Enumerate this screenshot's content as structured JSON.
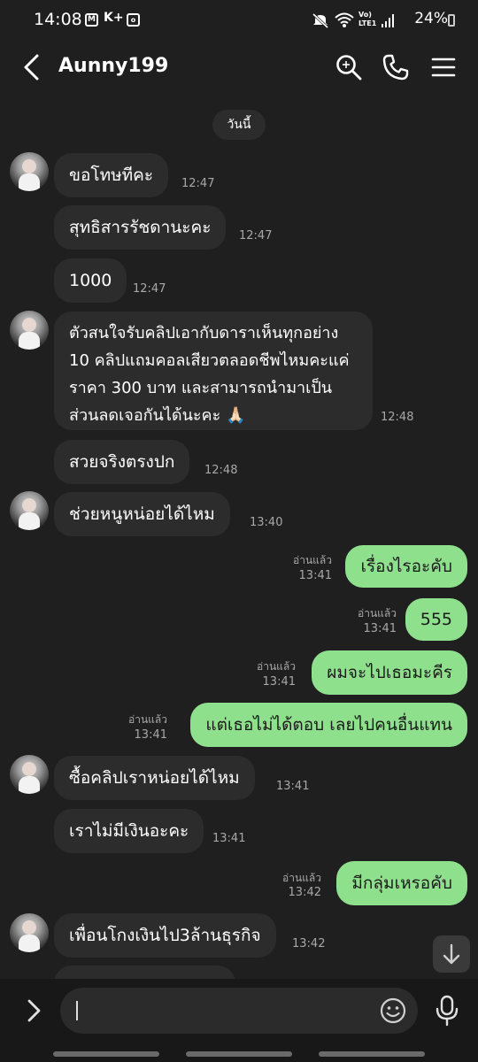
{
  "status_bar": {
    "time": "14:08",
    "icons_left": [
      "M",
      "K+"
    ],
    "network": "Vo) LTE1",
    "battery": "24%"
  },
  "header": {
    "title": "Aunny199",
    "back_icon": "back-arrow-icon",
    "actions": [
      "search-icon",
      "phone-icon",
      "menu-icon"
    ]
  },
  "chat": {
    "date_label": "วันนี้",
    "messages": [
      {
        "side": "in",
        "text": "ขอโทษทีคะ",
        "time": "12:47"
      },
      {
        "side": "in",
        "text": "สุทธิสารรัชดานะคะ",
        "time": "12:47"
      },
      {
        "side": "in",
        "text": "1000",
        "time": "12:47"
      },
      {
        "side": "in",
        "text": " ตัวสนใจรับคลิปเอากับดาราเห็นทุกอย่าง 10 คลิปแถมคอลเสียวตลอดชีพไหมคะแค่ราคา 300 บาท และสามารถนำมาเป็นส่วนลดเจอกันได้นะคะ 🙏🏻",
        "time": "12:48"
      },
      {
        "side": "in",
        "text": "สวยจริงตรงปก",
        "time": "12:48"
      },
      {
        "side": "in",
        "text": "ช่วยหนูหน่อยได้ไหม",
        "time": "13:40"
      },
      {
        "side": "out",
        "text": "เรื่องไรอะคับ",
        "read": "อ่านแล้ว",
        "time": "13:41"
      },
      {
        "side": "out",
        "text": "555",
        "read": "อ่านแล้ว",
        "time": "13:41"
      },
      {
        "side": "out",
        "text": "ผมจะไปเธอมะคีร",
        "read": "อ่านแล้ว",
        "time": "13:41"
      },
      {
        "side": "out",
        "text": "แต่เธอไม่ได้ตอบ เลยไปคนอื่นแทน",
        "read": "อ่านแล้ว",
        "time": "13:41"
      },
      {
        "side": "in",
        "text": "ซื้อคลิปเราหน่อยได้ไหม",
        "time": "13:41"
      },
      {
        "side": "in",
        "text": "เราไม่มีเงินอะคะ",
        "time": "13:41"
      },
      {
        "side": "out",
        "text": "มีกลุ่มเหรอคับ",
        "read": "อ่านแล้ว",
        "time": "13:42"
      },
      {
        "side": "in",
        "text": "เพื่อนโกงเงินไป3ล้านธุรกิจ",
        "time": "13:42"
      }
    ]
  },
  "input": {
    "placeholder": "",
    "expand_icon": "chevron-right-icon",
    "emoji_icon": "smiley-icon",
    "mic_icon": "microphone-icon"
  },
  "colors": {
    "background": "#1f1f1f",
    "incoming_bubble": "#2c2c2c",
    "outgoing_bubble": "#8fe08d",
    "timestamp": "#a8a8a8"
  }
}
